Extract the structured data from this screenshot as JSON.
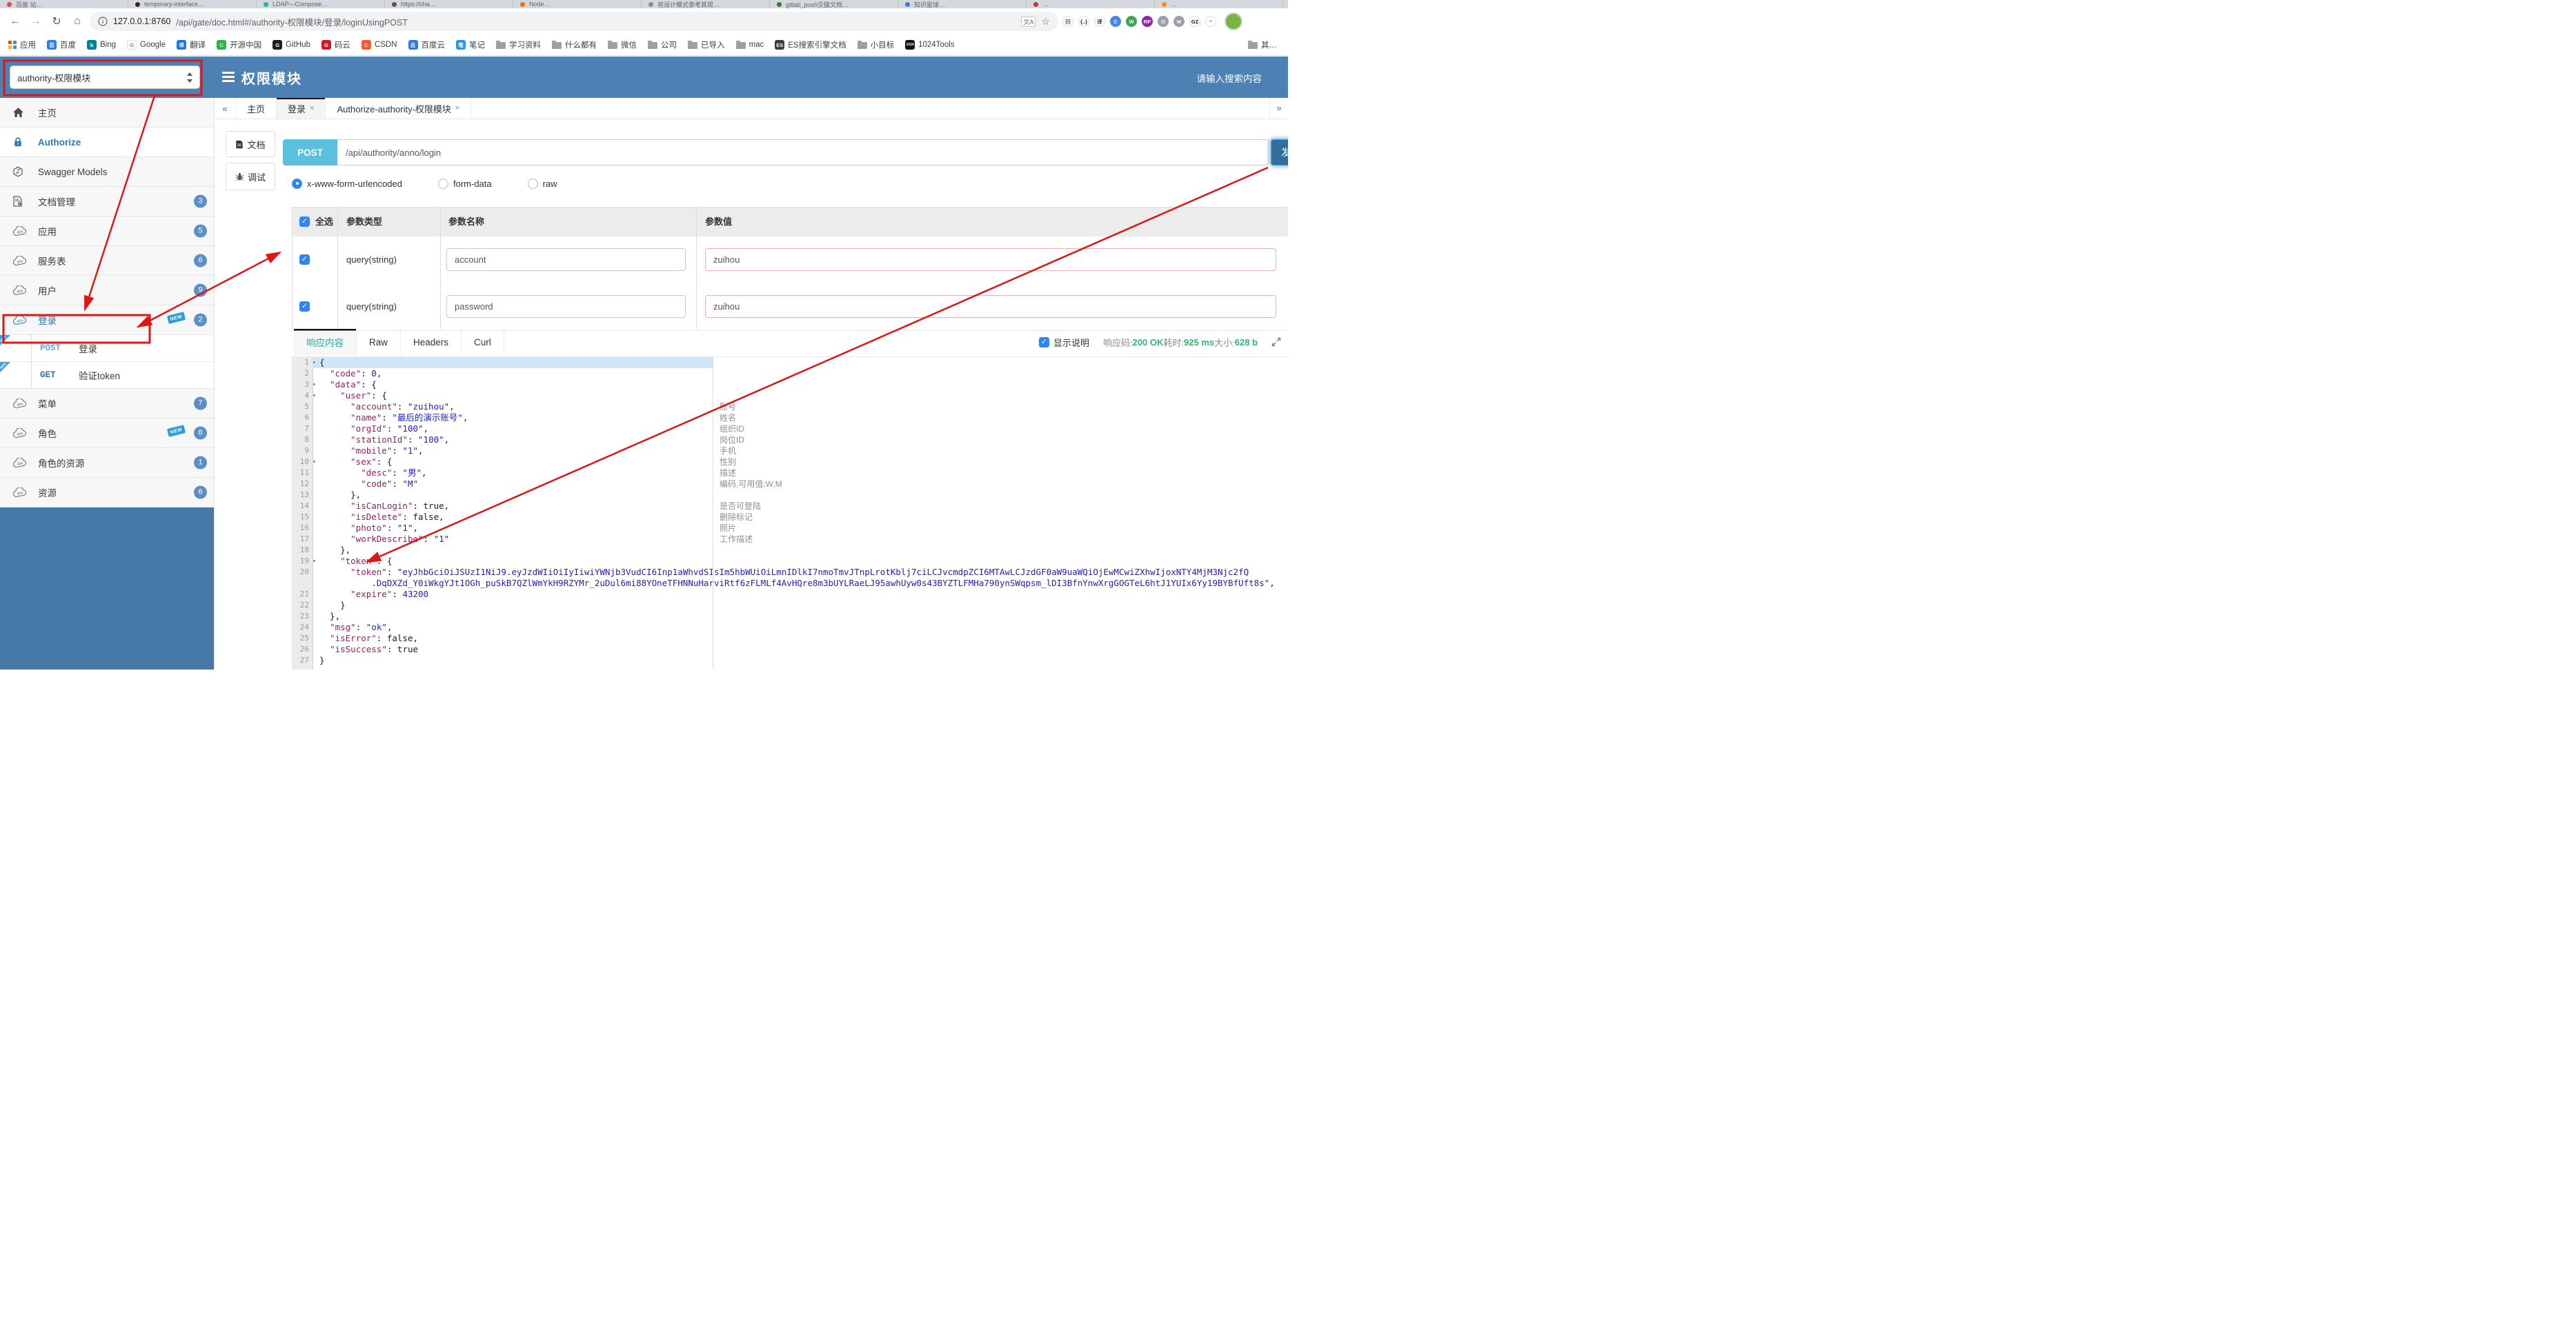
{
  "colors": {
    "brand_blue": "#4d80b3",
    "sidebar_bottom_blue": "#4678a8",
    "post_pill": "#5bc0de",
    "send_button": "#316f9e",
    "badge_blue": "#5b8fc7",
    "annotation_red": "#e01616",
    "status_green": "#33b571",
    "active_response_tab": "#2aa79b",
    "checkbox_blue": "#2e87f0"
  },
  "browser": {
    "tabs": [
      {
        "t": "百度 站…",
        "c": "#e04a3f"
      },
      {
        "t": "temporary-interface…",
        "c": "#2b2b2b"
      },
      {
        "t": "LDAP—Compose…",
        "c": "#1fb6a6"
      },
      {
        "t": "https://cha…",
        "c": "#555555"
      },
      {
        "t": "Node…",
        "c": "#e8710a"
      },
      {
        "t": "将设计模式参考其现…",
        "c": "#8a8a8a"
      },
      {
        "t": "gitlab_push交接文档…",
        "c": "#2e7d32"
      },
      {
        "t": "知识星球…",
        "c": "#3b78e7"
      },
      {
        "t": "…",
        "c": "#c0392b"
      },
      {
        "t": "…",
        "c": "#e8950a"
      }
    ],
    "url_host": "127.0.0.1:8760",
    "url_path": "/api/gate/doc.html#/authority-权限模块/登录/loginUsingPOST",
    "ext_icons": [
      {
        "g": "回",
        "bg": "#ffffff",
        "fg": "#5f6368",
        "bd": true,
        "n": "reader-extension-icon"
      },
      {
        "g": "{..}",
        "bg": "#ffffff",
        "fg": "#222222",
        "bd": true,
        "n": "json-extension-icon"
      },
      {
        "g": "译",
        "bg": "#ffffff",
        "fg": "#333333",
        "bd": true,
        "n": "translate-extension-icon"
      },
      {
        "g": "C",
        "bg": "#4285f4",
        "fg": "#ffffff",
        "n": "chrome-extension-icon"
      },
      {
        "g": "W",
        "bg": "#3aa757",
        "fg": "#ffffff",
        "n": "web-extension-icon"
      },
      {
        "g": "RP",
        "bg": "#8e24aa",
        "fg": "#ffffff",
        "n": "rp-extension-icon"
      },
      {
        "g": "O",
        "bg": "#9aa0a6",
        "fg": "#ffffff",
        "n": "o-extension-icon"
      },
      {
        "g": "M",
        "bg": "#9aa0a6",
        "fg": "#ffffff",
        "n": "m-extension-icon"
      },
      {
        "g": "GZ",
        "bg": "#ffffff",
        "fg": "#111111",
        "bd": true,
        "n": "gitzip-extension-icon"
      },
      {
        "g": "*",
        "bg": "#ffffff",
        "fg": "#7b61c4",
        "bd": true,
        "n": "asterisk-extension-icon"
      }
    ],
    "bookmarks": [
      {
        "t": "应用",
        "ic": "grid"
      },
      {
        "t": "百度",
        "ic": "chip",
        "bg": "#2680f7",
        "g": "百"
      },
      {
        "t": "Bing",
        "ic": "chip",
        "bg": "#00809d",
        "g": "b"
      },
      {
        "t": "Google",
        "ic": "chip",
        "bg": "#ffffff",
        "fg": "#4285f4",
        "g": "G",
        "bd": true
      },
      {
        "t": "翻译",
        "ic": "chip",
        "bg": "#1a73e8",
        "g": "译"
      },
      {
        "t": "开源中国",
        "ic": "chip",
        "bg": "#2bb24c",
        "g": "C"
      },
      {
        "t": "GitHub",
        "ic": "chip",
        "bg": "#1b1f23",
        "g": "G"
      },
      {
        "t": "码云",
        "ic": "chip",
        "bg": "#c71d23",
        "g": "G"
      },
      {
        "t": "CSDN",
        "ic": "chip",
        "bg": "#fc5531",
        "g": "C"
      },
      {
        "t": "百度云",
        "ic": "chip",
        "bg": "#2b7de1",
        "g": "云"
      },
      {
        "t": "笔记",
        "ic": "chip",
        "bg": "#2196f3",
        "g": "笔"
      },
      {
        "t": "学习资料",
        "ic": "folder"
      },
      {
        "t": "什么都有",
        "ic": "folder"
      },
      {
        "t": "微信",
        "ic": "folder"
      },
      {
        "t": "公司",
        "ic": "folder"
      },
      {
        "t": "已导入",
        "ic": "folder"
      },
      {
        "t": "mac",
        "ic": "folder"
      },
      {
        "t": "ES搜索引擎文档",
        "ic": "chip",
        "bg": "#3b3b3b",
        "g": "ES"
      },
      {
        "t": "小目标",
        "ic": "folder"
      },
      {
        "t": "1024Tools",
        "ic": "chip",
        "bg": "#111111",
        "g": "1024"
      },
      {
        "t": "其…",
        "ic": "folder",
        "right": true
      }
    ]
  },
  "header": {
    "module_select": "authority-权限模块",
    "title": "权限模块",
    "search_placeholder": "请输入搜索内容"
  },
  "sidebar": {
    "items": [
      {
        "name": "home",
        "label": "主页",
        "icon": "home"
      },
      {
        "name": "authorize",
        "label": "Authorize",
        "icon": "lock",
        "active": true,
        "blue": true,
        "bold": true
      },
      {
        "name": "swagger-models",
        "label": "Swagger Models",
        "icon": "hex"
      },
      {
        "name": "doc-manage",
        "label": "文档管理",
        "icon": "docgear",
        "badge": "3"
      },
      {
        "name": "application",
        "label": "应用",
        "icon": "cloud",
        "badge": "5"
      },
      {
        "name": "service-table",
        "label": "服务表",
        "icon": "cloud",
        "badge": "6"
      },
      {
        "name": "user",
        "label": "用户",
        "icon": "cloud",
        "badge": "9"
      },
      {
        "name": "login",
        "label": "登录",
        "icon": "cloud",
        "badge": "2",
        "isNew": true,
        "blue": true
      },
      {
        "name": "login-post",
        "label": "登录",
        "method": "POST",
        "child": true,
        "ribbon": true
      },
      {
        "name": "verify-token-get",
        "label": "验证token",
        "method": "GET",
        "child": true,
        "ribbon": true
      },
      {
        "name": "menu",
        "label": "菜单",
        "icon": "cloud",
        "badge": "7"
      },
      {
        "name": "role",
        "label": "角色",
        "icon": "cloud",
        "badge": "8",
        "isNew": true
      },
      {
        "name": "role-resource",
        "label": "角色的资源",
        "icon": "cloud",
        "badge": "1"
      },
      {
        "name": "resource",
        "label": "资源",
        "icon": "cloud",
        "badge": "6"
      }
    ]
  },
  "tabbar": {
    "scroll_left": "«",
    "scroll_right": "»",
    "tabs": [
      {
        "label": "主页"
      },
      {
        "label": "登录",
        "close": "×",
        "active": true
      },
      {
        "label": "Authorize-authority-权限模块",
        "close": "×"
      }
    ]
  },
  "doc_tabs": {
    "doc": "文档",
    "debug": "调试"
  },
  "request": {
    "method": "POST",
    "url": "/api/authority/anno/login",
    "send_label": "发",
    "body_types": [
      {
        "label": "x-www-form-urlencoded",
        "selected": true
      },
      {
        "label": "form-data",
        "selected": false
      },
      {
        "label": "raw",
        "selected": false
      }
    ]
  },
  "params": {
    "headers": [
      "全选",
      "参数类型",
      "参数名称",
      "参数值"
    ],
    "rows": [
      {
        "type": "query(string)",
        "name": "account",
        "value": "zuihou",
        "checked": true
      },
      {
        "type": "query(string)",
        "name": "password",
        "value": "zuihou",
        "checked": true
      }
    ]
  },
  "response": {
    "tabs": [
      {
        "label": "响应内容",
        "active": true
      },
      {
        "label": "Raw"
      },
      {
        "label": "Headers"
      },
      {
        "label": "Curl"
      }
    ],
    "show_desc_label": "显示说明",
    "show_desc_checked": true,
    "status": [
      {
        "label": "响应码:",
        "value": "200 OK"
      },
      {
        "label": "耗时:",
        "value": "925 ms"
      },
      {
        "label": "大小:",
        "value": "628 b"
      }
    ]
  },
  "code": {
    "lines": [
      {
        "n": "1",
        "fold": true,
        "hl": true,
        "seg": [
          [
            "p",
            "{"
          ]
        ]
      },
      {
        "n": "2",
        "seg": [
          [
            "p",
            "  "
          ],
          [
            "k",
            "\"code\""
          ],
          [
            "p",
            ": "
          ],
          [
            "n",
            "0"
          ],
          [
            "p",
            ","
          ]
        ]
      },
      {
        "n": "3",
        "fold": true,
        "seg": [
          [
            "p",
            "  "
          ],
          [
            "k",
            "\"data\""
          ],
          [
            "p",
            ": {"
          ]
        ]
      },
      {
        "n": "4",
        "fold": true,
        "seg": [
          [
            "p",
            "    "
          ],
          [
            "k",
            "\"user\""
          ],
          [
            "p",
            ": {"
          ]
        ]
      },
      {
        "n": "5",
        "ann": "账号",
        "seg": [
          [
            "p",
            "      "
          ],
          [
            "k",
            "\"account\""
          ],
          [
            "p",
            ": "
          ],
          [
            "s",
            "\"zuihou\""
          ],
          [
            "p",
            ","
          ]
        ]
      },
      {
        "n": "6",
        "ann": "姓名",
        "seg": [
          [
            "p",
            "      "
          ],
          [
            "k",
            "\"name\""
          ],
          [
            "p",
            ": "
          ],
          [
            "s",
            "\"最后的演示账号\""
          ],
          [
            "p",
            ","
          ]
        ]
      },
      {
        "n": "7",
        "ann": "组织ID",
        "seg": [
          [
            "p",
            "      "
          ],
          [
            "k",
            "\"orgId\""
          ],
          [
            "p",
            ": "
          ],
          [
            "s",
            "\"100\""
          ],
          [
            "p",
            ","
          ]
        ]
      },
      {
        "n": "8",
        "ann": "岗位ID",
        "seg": [
          [
            "p",
            "      "
          ],
          [
            "k",
            "\"stationId\""
          ],
          [
            "p",
            ": "
          ],
          [
            "s",
            "\"100\""
          ],
          [
            "p",
            ","
          ]
        ]
      },
      {
        "n": "9",
        "ann": "手机",
        "seg": [
          [
            "p",
            "      "
          ],
          [
            "k",
            "\"mobile\""
          ],
          [
            "p",
            ": "
          ],
          [
            "s",
            "\"1\""
          ],
          [
            "p",
            ","
          ]
        ]
      },
      {
        "n": "10",
        "fold": true,
        "ann": "性别",
        "seg": [
          [
            "p",
            "      "
          ],
          [
            "k",
            "\"sex\""
          ],
          [
            "p",
            ": {"
          ]
        ]
      },
      {
        "n": "11",
        "ann": "描述",
        "seg": [
          [
            "p",
            "        "
          ],
          [
            "k",
            "\"desc\""
          ],
          [
            "p",
            ": "
          ],
          [
            "s",
            "\"男\""
          ],
          [
            "p",
            ","
          ]
        ]
      },
      {
        "n": "12",
        "ann": "编码,可用值:W,M",
        "seg": [
          [
            "p",
            "        "
          ],
          [
            "k",
            "\"code\""
          ],
          [
            "p",
            ": "
          ],
          [
            "s",
            "\"M\""
          ]
        ]
      },
      {
        "n": "13",
        "seg": [
          [
            "p",
            "      },"
          ]
        ]
      },
      {
        "n": "14",
        "ann": "是否可登陆",
        "seg": [
          [
            "p",
            "      "
          ],
          [
            "k",
            "\"isCanLogin\""
          ],
          [
            "p",
            ": "
          ],
          [
            "b",
            "true"
          ],
          [
            "p",
            ","
          ]
        ]
      },
      {
        "n": "15",
        "ann": "删除标记",
        "seg": [
          [
            "p",
            "      "
          ],
          [
            "k",
            "\"isDelete\""
          ],
          [
            "p",
            ": "
          ],
          [
            "b",
            "false"
          ],
          [
            "p",
            ","
          ]
        ]
      },
      {
        "n": "16",
        "ann": "照片",
        "seg": [
          [
            "p",
            "      "
          ],
          [
            "k",
            "\"photo\""
          ],
          [
            "p",
            ": "
          ],
          [
            "s",
            "\"1\""
          ],
          [
            "p",
            ","
          ]
        ]
      },
      {
        "n": "17",
        "ann": "工作描述",
        "seg": [
          [
            "p",
            "      "
          ],
          [
            "k",
            "\"workDescribe\""
          ],
          [
            "p",
            ": "
          ],
          [
            "s",
            "\"1\""
          ]
        ]
      },
      {
        "n": "18",
        "seg": [
          [
            "p",
            "    },"
          ]
        ]
      },
      {
        "n": "19",
        "fold": true,
        "seg": [
          [
            "p",
            "    "
          ],
          [
            "k",
            "\"token\""
          ],
          [
            "p",
            ": {"
          ]
        ]
      },
      {
        "n": "20",
        "seg": [
          [
            "p",
            "      "
          ],
          [
            "k",
            "\"token\""
          ],
          [
            "p",
            ": "
          ],
          [
            "s",
            "\"eyJhbGciOiJSUzI1NiJ9.eyJzdWIiOiIyIiwiYWNjb3VudCI6Inp1aWhvdSIsIm5hbWUiOiLmnIDlkI7nmoTmvJTnpLrotKblj7ciLCJvcmdpZCI6MTAwLCJzdGF0aW9uaWQiOjEwMCwiZXhwIjoxNTY4MjM3Njc2fQ"
          ]
        ]
      },
      {
        "n": "",
        "seg": [
          [
            "s",
            "          .DqDXZd_Y0iWkgYJt1OGh_puSkB7QZlWmYkH9RZYMr_2uDul6mi88YOneTFHNNuHarviRtf6zFLMLf4AvHQre8m3bUYLRaeLJ95awhUyw0s43BYZTLFMHa790ynSWqpsm_lDI3BfnYnwXrgGOGTeL6htJ1YUIx6Yy19BYBfUft8s\""
          ],
          [
            "p",
            ","
          ]
        ]
      },
      {
        "n": "21",
        "seg": [
          [
            "p",
            "      "
          ],
          [
            "k",
            "\"expire\""
          ],
          [
            "p",
            ": "
          ],
          [
            "n",
            "43200"
          ]
        ]
      },
      {
        "n": "22",
        "seg": [
          [
            "p",
            "    }"
          ]
        ]
      },
      {
        "n": "23",
        "seg": [
          [
            "p",
            "  },"
          ]
        ]
      },
      {
        "n": "24",
        "seg": [
          [
            "p",
            "  "
          ],
          [
            "k",
            "\"msg\""
          ],
          [
            "p",
            ": "
          ],
          [
            "s",
            "\"ok\""
          ],
          [
            "p",
            ","
          ]
        ]
      },
      {
        "n": "25",
        "seg": [
          [
            "p",
            "  "
          ],
          [
            "k",
            "\"isError\""
          ],
          [
            "p",
            ": "
          ],
          [
            "b",
            "false"
          ],
          [
            "p",
            ","
          ]
        ]
      },
      {
        "n": "26",
        "seg": [
          [
            "p",
            "  "
          ],
          [
            "k",
            "\"isSuccess\""
          ],
          [
            "p",
            ": "
          ],
          [
            "b",
            "true"
          ]
        ]
      },
      {
        "n": "27",
        "seg": [
          [
            "p",
            "}"
          ]
        ]
      }
    ]
  }
}
